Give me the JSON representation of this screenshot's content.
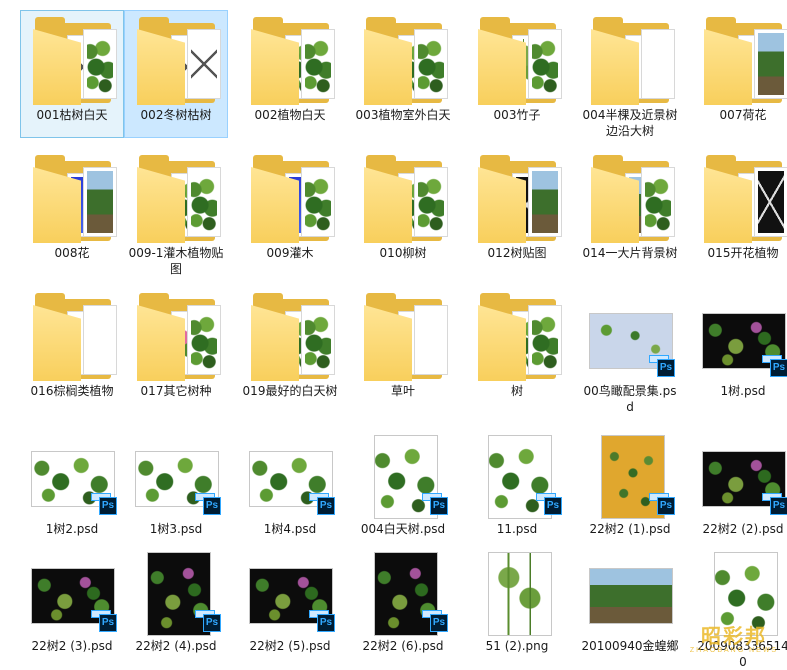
{
  "items": [
    {
      "name": "001枯树白天",
      "type": "folder",
      "state": "selected",
      "paper1": "tex-bare",
      "paper2": "tex-green"
    },
    {
      "name": "002冬树枯树",
      "type": "folder",
      "state": "highlight",
      "paper1": "tex-bare",
      "paper2": "tex-bare"
    },
    {
      "name": "002植物白天",
      "type": "folder",
      "paper1": "tex-green",
      "paper2": "tex-green"
    },
    {
      "name": "003植物室外白天",
      "type": "folder",
      "paper1": "tex-green",
      "paper2": "tex-green"
    },
    {
      "name": "003竹子",
      "type": "folder",
      "paper1": "tex-bamboo",
      "paper2": "tex-green"
    },
    {
      "name": "004半棵及近景树边沿大树",
      "type": "folder",
      "paper1": "tex-white",
      "paper2": "tex-white"
    },
    {
      "name": "007荷花",
      "type": "folder",
      "paper1": "tex-white",
      "paper2": "tex-photo"
    },
    {
      "name": "008花",
      "type": "folder",
      "paper1": "tex-blueart",
      "paper2": "tex-photo"
    },
    {
      "name": "009-1灌木植物贴图",
      "type": "folder",
      "paper1": "tex-green",
      "paper2": "tex-green"
    },
    {
      "name": "009灌木",
      "type": "folder",
      "paper1": "tex-blueart",
      "paper2": "tex-green"
    },
    {
      "name": "010柳树",
      "type": "folder",
      "paper1": "tex-green",
      "paper2": "tex-green"
    },
    {
      "name": "012树贴图",
      "type": "folder",
      "paper1": "tex-blackpalm",
      "paper2": "tex-photo"
    },
    {
      "name": "014一大片背景树",
      "type": "folder",
      "paper1": "tex-photo",
      "paper2": "tex-green"
    },
    {
      "name": "015开花植物",
      "type": "folder",
      "paper1": "tex-white",
      "paper2": "tex-blackpalm"
    },
    {
      "name": "016棕榈类植物",
      "type": "folder",
      "paper1": "tex-white",
      "paper2": "tex-white"
    },
    {
      "name": "017其它树种",
      "type": "folder",
      "paper1": "tex-floral",
      "paper2": "tex-green"
    },
    {
      "name": "019最好的白天树",
      "type": "folder",
      "paper1": "tex-green",
      "paper2": "tex-green"
    },
    {
      "name": "草叶",
      "type": "folder",
      "paper1": "tex-white",
      "paper2": "tex-white"
    },
    {
      "name": "树",
      "type": "folder",
      "paper1": "tex-green",
      "paper2": "tex-green"
    },
    {
      "name": "00鸟瞰配景集.psd",
      "type": "psd",
      "tex": "tex-blue"
    },
    {
      "name": "1树.psd",
      "type": "psd",
      "tex": "tex-dark"
    },
    {
      "name": "1树2.psd",
      "type": "psd",
      "tex": "tex-green"
    },
    {
      "name": "1树3.psd",
      "type": "psd",
      "tex": "tex-green"
    },
    {
      "name": "1树4.psd",
      "type": "psd",
      "tex": "tex-green"
    },
    {
      "name": "004白天树.psd",
      "type": "psd",
      "tex": "tex-green",
      "tall": true
    },
    {
      "name": "11.psd",
      "type": "psd",
      "tex": "tex-green",
      "tall": true
    },
    {
      "name": "22树2 (1).psd",
      "type": "psd",
      "tex": "tex-orange",
      "tall": true
    },
    {
      "name": "22树2 (2).psd",
      "type": "psd",
      "tex": "tex-dark"
    },
    {
      "name": "22树2 (3).psd",
      "type": "psd",
      "tex": "tex-dark"
    },
    {
      "name": "22树2 (4).psd",
      "type": "psd",
      "tex": "tex-dark",
      "tall": true
    },
    {
      "name": "22树2 (5).psd",
      "type": "psd",
      "tex": "tex-dark"
    },
    {
      "name": "22树2 (6).psd",
      "type": "psd",
      "tex": "tex-dark",
      "tall": true
    },
    {
      "name": "51 (2).png",
      "type": "png",
      "tex": "tex-bamboo",
      "tall": true
    },
    {
      "name": "20100940金蝗鄉",
      "type": "img",
      "tex": "tex-photo"
    },
    {
      "name": "2009083365140",
      "type": "img",
      "tex": "tex-green",
      "tall": true
    }
  ],
  "icons": {
    "folder": "folder-icon",
    "psd": "photoshop-icon",
    "badge_text": "Ps"
  },
  "watermark": {
    "main": "昭彩邦",
    "sub": "ZHAOBANG NEWS"
  }
}
